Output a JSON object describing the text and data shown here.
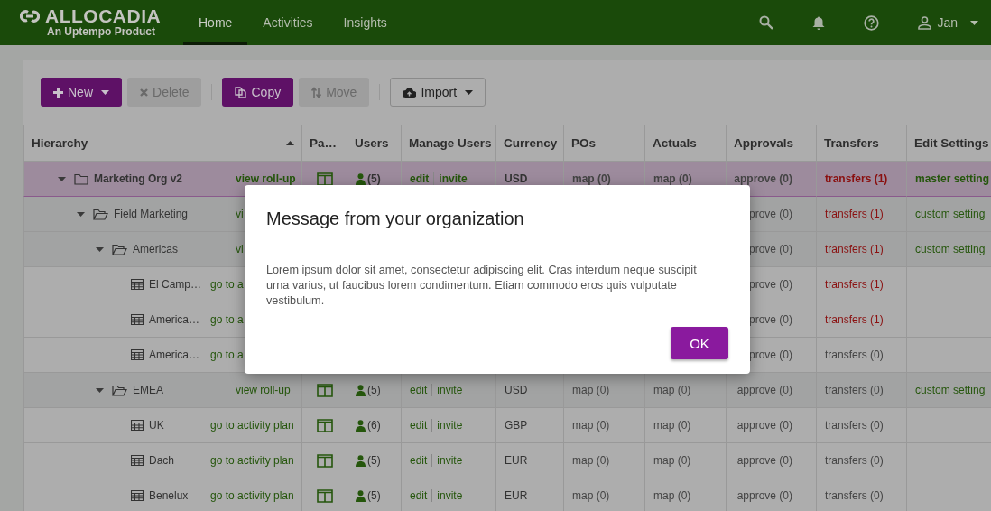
{
  "header": {
    "logo": {
      "name": "ALLOCADIA",
      "tagline": "An Uptempo Product"
    },
    "tabs": [
      {
        "label": "Home",
        "selected": true
      },
      {
        "label": "Activities",
        "selected": false
      },
      {
        "label": "Insights",
        "selected": false
      }
    ],
    "user": {
      "name": "Jan"
    }
  },
  "toolbar": {
    "groups": [
      [
        {
          "label": "New",
          "kind": "primary",
          "disabled": false,
          "menu": true
        },
        {
          "label": "Delete",
          "kind": "primary",
          "disabled": true,
          "menu": false
        }
      ],
      [
        {
          "label": "Copy",
          "kind": "primary",
          "disabled": false,
          "menu": false
        },
        {
          "label": "Move",
          "kind": "primary",
          "disabled": true,
          "menu": false
        }
      ],
      [
        {
          "label": "Import",
          "kind": "outline",
          "disabled": false,
          "menu": true
        }
      ]
    ]
  },
  "table": {
    "columns": [
      {
        "label": "Hierarchy",
        "sorted": true
      },
      {
        "label": "Pa…"
      },
      {
        "label": "Users"
      },
      {
        "label": "Manage Users"
      },
      {
        "label": "Currency"
      },
      {
        "label": "POs"
      },
      {
        "label": "Actuals"
      },
      {
        "label": "Approvals"
      },
      {
        "label": "Transfers"
      },
      {
        "label": "Edit Settings"
      }
    ],
    "rows": [
      {
        "kind": "org",
        "name": "Marketing Org v2",
        "action": "view roll-up",
        "expanded": true,
        "selected": true,
        "users": "(5)",
        "manage": [
          "edit",
          "invite"
        ],
        "currency": "USD",
        "pos": "map (0)",
        "actuals": "map (0)",
        "approvals": "approve (0)",
        "transfers": "transfers (1)",
        "transfers_pending": true,
        "settings": "master setting",
        "children": [
          {
            "kind": "folder",
            "name": "Field Marketing",
            "action": "vi",
            "expanded": true,
            "selected": false,
            "approvals": "prove (0)",
            "transfers": "transfers (1)",
            "transfers_pending": true,
            "settings": "custom setting",
            "children": [
              {
                "kind": "folder",
                "name": "Americas",
                "action": "vi",
                "expanded": true,
                "selected": false,
                "approvals": "prove (0)",
                "transfers": "transfers (1)",
                "transfers_pending": true,
                "settings": "custom setting",
                "children": [
                  {
                    "kind": "plan",
                    "name": "El Camp…",
                    "action": "go to a",
                    "selected": false,
                    "approvals": "prove (0)",
                    "transfers": "transfers (1)",
                    "transfers_pending": true
                  },
                  {
                    "kind": "plan",
                    "name": "America…",
                    "action": "go to a",
                    "selected": false,
                    "approvals": "prove (0)",
                    "transfers": "transfers (1)",
                    "transfers_pending": true
                  },
                  {
                    "kind": "plan",
                    "name": "America…",
                    "action": "go to a",
                    "selected": false,
                    "approvals": "prove (0)",
                    "transfers": "transfers (0)",
                    "transfers_pending": false
                  }
                ]
              },
              {
                "kind": "folder",
                "name": "EMEA",
                "action": "view roll-up",
                "expanded": true,
                "selected": false,
                "users": "(5)",
                "manage": [
                  "edit",
                  "invite"
                ],
                "currency": "USD",
                "pos": "map (0)",
                "actuals": "map (0)",
                "approvals": "approve (0)",
                "transfers": "transfers (0)",
                "transfers_pending": false,
                "settings": "custom setting",
                "children": [
                  {
                    "kind": "plan",
                    "name": "UK",
                    "action": "go to activity plan",
                    "selected": false,
                    "users": "(6)",
                    "manage": [
                      "edit",
                      "invite"
                    ],
                    "currency": "GBP",
                    "pos": "map (0)",
                    "actuals": "map (0)",
                    "approvals": "approve (0)",
                    "transfers": "transfers (0)",
                    "transfers_pending": false
                  },
                  {
                    "kind": "plan",
                    "name": "Dach",
                    "action": "go to activity plan",
                    "selected": false,
                    "users": "(5)",
                    "manage": [
                      "edit",
                      "invite"
                    ],
                    "currency": "EUR",
                    "pos": "map (0)",
                    "actuals": "map (0)",
                    "approvals": "approve (0)",
                    "transfers": "transfers (0)",
                    "transfers_pending": false
                  },
                  {
                    "kind": "plan",
                    "name": "Benelux",
                    "action": "go to activity plan",
                    "selected": false,
                    "users": "(5)",
                    "manage": [
                      "edit",
                      "invite"
                    ],
                    "currency": "EUR",
                    "pos": "map (0)",
                    "actuals": "map (0)",
                    "approvals": "approve (0)",
                    "transfers": "transfers (0)",
                    "transfers_pending": false
                  }
                ]
              }
            ]
          }
        ]
      }
    ]
  },
  "dialog": {
    "title": "Message from your organization",
    "body": "Lorem ipsum dolor sit amet, consectetur adipiscing elit. Cras interdum neque suscipit urna varius, ut faucibus lorem condimentum. Etiam commodo eros quis vulputate vestibulum.",
    "button": "OK"
  }
}
